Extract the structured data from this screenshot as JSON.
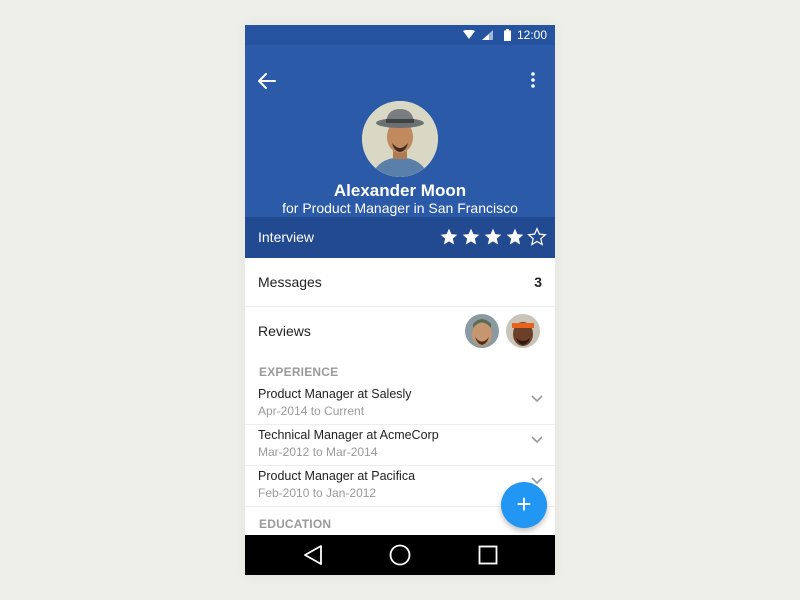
{
  "status_bar": {
    "time": "12:00",
    "icons": [
      "wifi-icon",
      "signal-icon",
      "battery-icon"
    ]
  },
  "header": {
    "back_icon": "back-arrow-icon",
    "menu_icon": "more-vert-icon",
    "name": "Alexander Moon",
    "subtitle": "for  Product Manager in San Francisco",
    "colors": {
      "header_bg": "#2a5aa8",
      "stage_bg": "#224a90"
    }
  },
  "stage": {
    "label": "Interview",
    "rating": 4,
    "max_rating": 5
  },
  "messages": {
    "label": "Messages",
    "count": "3"
  },
  "reviews": {
    "label": "Reviews",
    "reviewer_avatars": [
      "reviewer-avatar-1",
      "reviewer-avatar-2"
    ]
  },
  "experience": {
    "title": "EXPERIENCE",
    "items": [
      {
        "title": "Product Manager at Salesly",
        "dates": "Apr-2014 to Current"
      },
      {
        "title": "Technical Manager at AcmeCorp",
        "dates": "Mar-2012 to Mar-2014"
      },
      {
        "title": "Product Manager at Pacifica",
        "dates": "Feb-2010 to Jan-2012"
      }
    ]
  },
  "education": {
    "title": "EDUCATION"
  },
  "fab": {
    "label": "+",
    "color": "#2196f3"
  },
  "nav_bar": {
    "buttons": [
      "back-nav-icon",
      "home-nav-icon",
      "recents-nav-icon"
    ]
  }
}
